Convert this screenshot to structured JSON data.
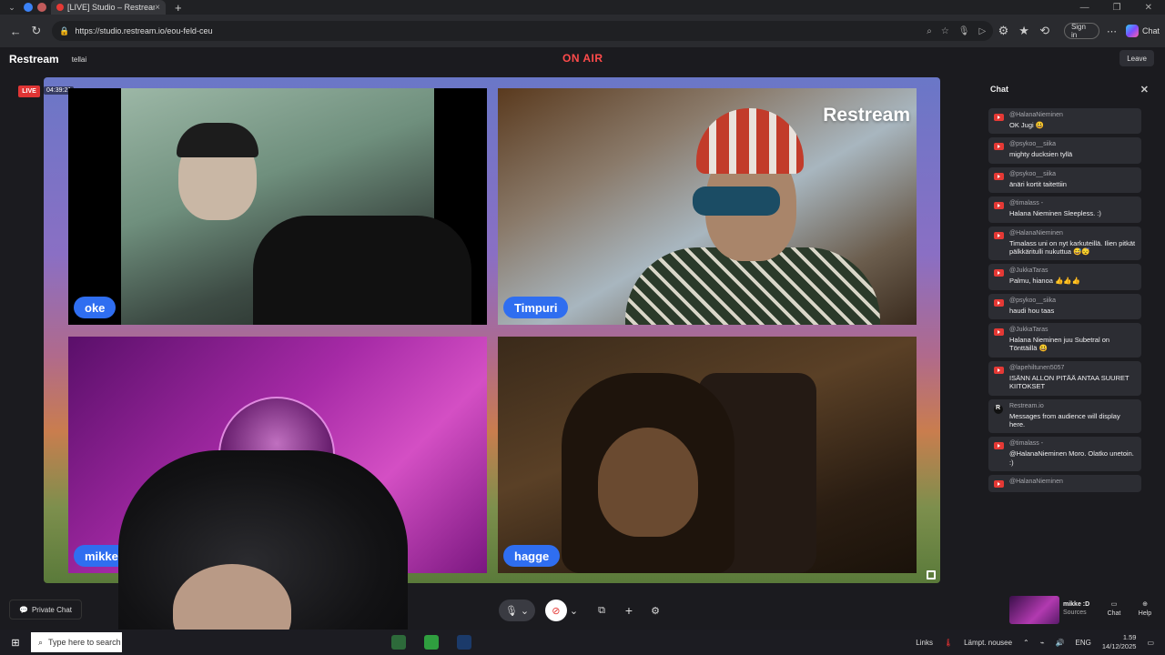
{
  "browser": {
    "tab_title": "[LIVE] Studio – Restream",
    "tab_close": "×",
    "new_tab": "+",
    "url": "https://studio.restream.io/eou-feld-ceu",
    "sign_in": "Sign in",
    "copilot_label": "Chat",
    "window_controls": [
      "—",
      "❐",
      "✕"
    ]
  },
  "studio": {
    "brand": "Restream",
    "studio_name": "tellai",
    "on_air": "ON AIR",
    "leave": "Leave",
    "live_badge": "LIVE",
    "timer": "04:39:21"
  },
  "participants": [
    {
      "name": "oke"
    },
    {
      "name": "Timpuri"
    },
    {
      "name": "mikke :D"
    },
    {
      "name": "hagge"
    }
  ],
  "watermark": "Restream",
  "chat": {
    "title": "Chat",
    "messages": [
      {
        "author": "@HalanaNieminen",
        "text": "OK Jugi 😃",
        "source": "youtube"
      },
      {
        "author": "@psykoo__siika",
        "text": "mighty ducksien tyllä",
        "source": "youtube"
      },
      {
        "author": "@psykoo__siika",
        "text": "änäri kortit taitettiin",
        "source": "youtube"
      },
      {
        "author": "@timalass -",
        "text": "Halana Nieminen Sleepless. :)",
        "source": "youtube"
      },
      {
        "author": "@HalanaNieminen",
        "text": "Timalass uni on nyt karkuteillä. Ilien pitkät pälkkäritulli nukuttua 😅😴",
        "source": "youtube"
      },
      {
        "author": "@JukkaTaras",
        "text": "Palmu, hianoa 👍👍👍",
        "source": "youtube"
      },
      {
        "author": "@psykoo__siika",
        "text": "haudi hou taas",
        "source": "youtube"
      },
      {
        "author": "@JukkaTaras",
        "text": "Halana Nieminen juu Subetral on Tönttäillä 😃",
        "source": "youtube"
      },
      {
        "author": "@lapehiltunen5057",
        "text": "ISÄNN ALLON PITÄÄ ANTAA SUURET KIITOKSET",
        "source": "youtube"
      },
      {
        "author": "Restream.io",
        "text": "Messages from audience will display here.",
        "source": "restream"
      },
      {
        "author": "@timalass -",
        "text": "@HalanaNieminen Moro. Olatko unetoin. :)",
        "source": "youtube"
      },
      {
        "author": "@HalanaNieminen",
        "text": "",
        "source": "youtube"
      }
    ]
  },
  "bottom_bar": {
    "private_chat": "Private Chat",
    "sources_name": "mikke :D",
    "sources_label": "Sources",
    "chat_label": "Chat",
    "help_label": "Help"
  },
  "taskbar": {
    "search_placeholder": "Type here to search",
    "links": "Links",
    "weather": "Lämpt. nousee",
    "language": "ENG",
    "time": "1.59",
    "date": "14/12/2025"
  }
}
